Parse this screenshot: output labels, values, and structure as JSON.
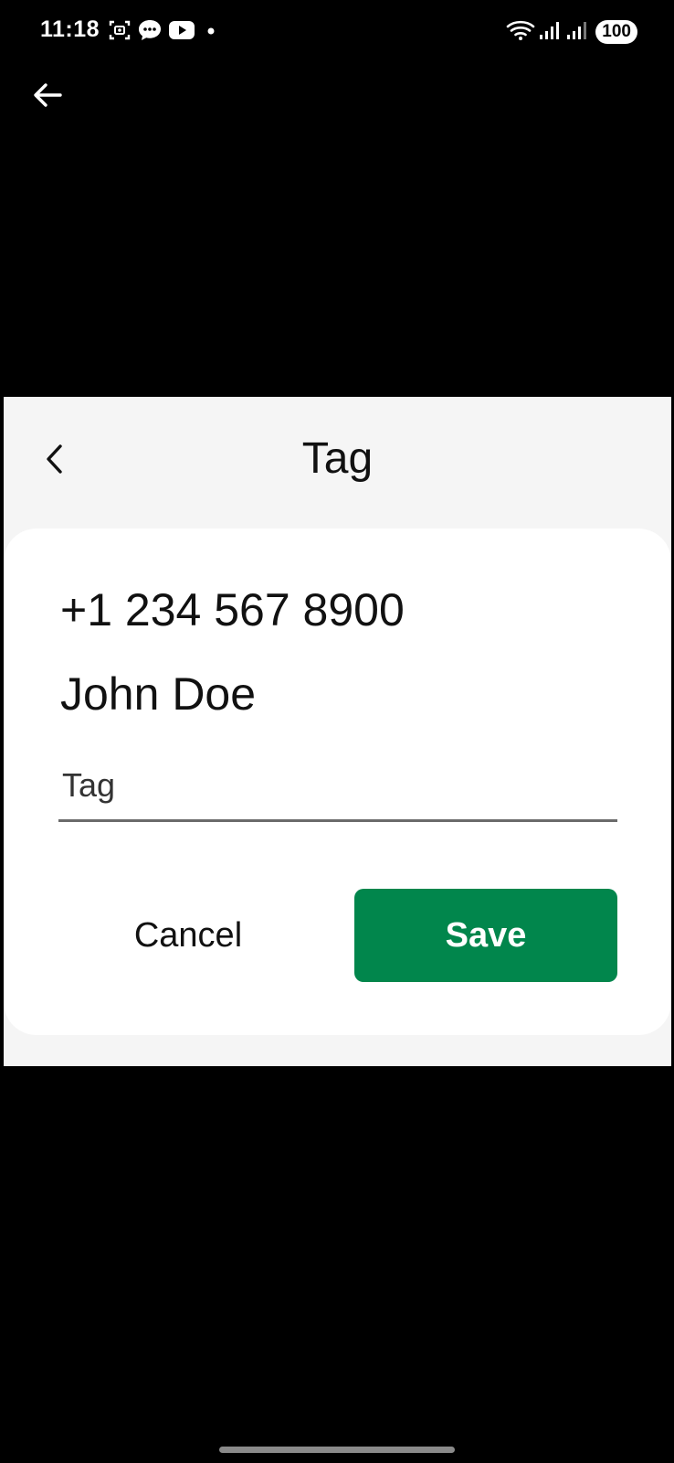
{
  "status_bar": {
    "time": "11:18",
    "battery": "100",
    "icons_left": [
      "screen-record-icon",
      "message-bubble-icon",
      "youtube-icon",
      "dot-icon"
    ],
    "icons_right": [
      "wifi-icon",
      "signal-icon-1",
      "signal-icon-2",
      "battery-icon"
    ]
  },
  "top_nav": {
    "back_icon": "arrow-left-icon"
  },
  "dialog": {
    "back_icon": "chevron-left-icon",
    "title": "Tag",
    "phone_number": "+1 234 567 8900",
    "contact_name": "John Doe",
    "tag_input": {
      "placeholder": "Tag",
      "value": ""
    },
    "cancel_label": "Cancel",
    "save_label": "Save"
  },
  "colors": {
    "save_button": "#01864c",
    "panel_bg": "#f5f5f5",
    "card_bg": "#ffffff",
    "screen_bg": "#000000"
  }
}
